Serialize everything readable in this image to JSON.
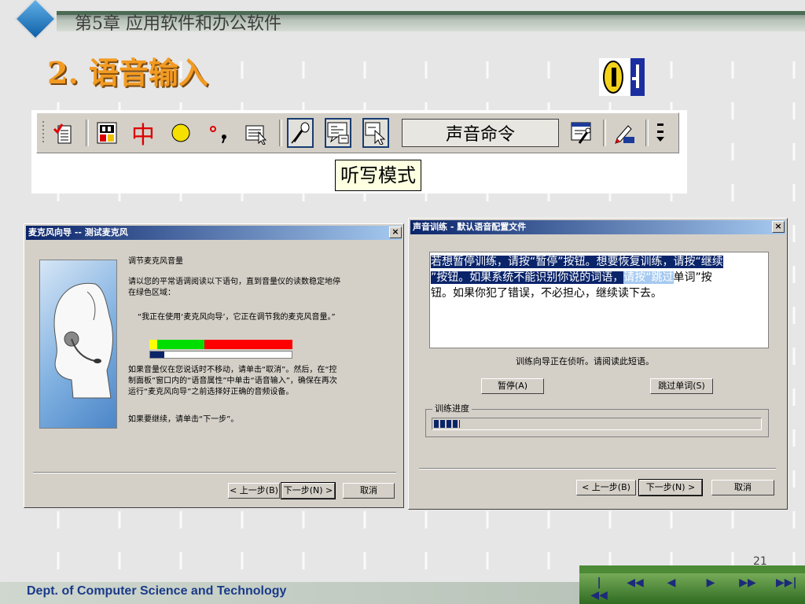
{
  "header": {
    "chapter_title": "第5章  应用软件和办公软件"
  },
  "slide": {
    "title": "2. 语音输入",
    "page_number": "21"
  },
  "language_bar": {
    "icons": [
      "correction-icon",
      "handwriting-pad-icon",
      "chinese-mode-icon",
      "round-icon",
      "punctuation-icon",
      "soft-keyboard-icon",
      "microphone-icon",
      "dictation-mode-icon",
      "voice-command-icon",
      "speech-tools-icon",
      "write-pad-icon",
      "options-icon"
    ],
    "ime_label": "中",
    "command_box": "声音命令",
    "tooltip": "听写模式"
  },
  "mic_wizard": {
    "title": "麦克风向导 -- 测试麦克风",
    "heading": "调节麦克风音量",
    "intro": "请以您的平常语调阅读以下语句，直到音量仪的读数稳定地停在绿色区域：",
    "quote": "“我正在使用‘麦克风向导’，它正在调节我的麦克风音量。”",
    "help": "如果音量仪在您说话时不移动，请单击“取消”。然后，在“控制面板”窗口内的“语音属性”中单击“语音输入”，确保在再次运行“麦克风向导”之前选择好正确的音频设备。",
    "continue": "如果要继续，请单击“下一步”。",
    "level": 0.1,
    "buttons": {
      "back": "< 上一步(B)",
      "next": "下一步(N) >",
      "cancel": "取消"
    }
  },
  "voice_training": {
    "title": "声音训练 - 默认语音配置文件",
    "sel_line1": "若想暂停训练，请按“暂停”按钮。想要恢复训练，请按“继续",
    "sel_line2a": "”按钮。如果系统不能识别你说的词语，",
    "sel_line2b": "请按“跳过",
    "sel_line2c": "单词”按",
    "line3": "钮。如果你犯了错误，不必担心，继续读下去。",
    "status": "训练向导正在侦听。请阅读此短语。",
    "pause_button": "暂停(A)",
    "skip_button": "跳过单词(S)",
    "progress_label": "训练进度",
    "progress": 0.08,
    "buttons": {
      "back": "< 上一步(B)",
      "next": "下一步(N) >",
      "cancel": "取消"
    }
  },
  "footer": {
    "department": "Dept. of Computer Science and Technology",
    "nav": [
      "|◀◀",
      "◀◀",
      "◀",
      "▶",
      "▶▶",
      "▶▶|"
    ]
  },
  "colors": {
    "title_orange": "#f29a22",
    "footer_blue": "#1a3a8a",
    "highlight": "#0a246a"
  }
}
